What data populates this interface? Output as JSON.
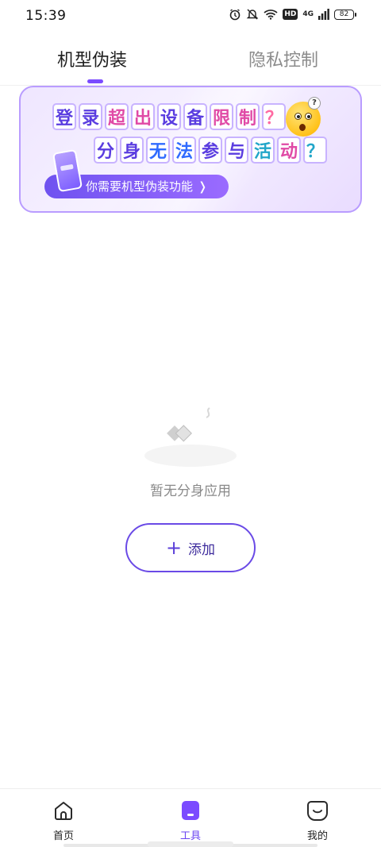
{
  "status_bar": {
    "time": "15:39",
    "hd": "HD",
    "network": "4G",
    "battery": "82",
    "icons": [
      "alarm-icon",
      "mute-icon",
      "wifi-icon",
      "hd-badge",
      "signal-icon",
      "battery-icon"
    ]
  },
  "tabs": [
    {
      "label": "机型伪装",
      "active": true
    },
    {
      "label": "隐私控制",
      "active": false
    }
  ],
  "banner": {
    "line1": [
      "登",
      "录",
      "超",
      "出",
      "设",
      "备",
      "限",
      "制",
      "？"
    ],
    "line2": [
      "分",
      "身",
      "无",
      "法",
      "参",
      "与",
      "活",
      "动",
      "？"
    ],
    "emoji_badge": "?",
    "pill_text": "你需要机型伪装功能",
    "pill_chevron": "❭"
  },
  "empty_state": {
    "message": "暂无分身应用"
  },
  "add_button": {
    "icon": "+",
    "label": "添加"
  },
  "bottom_nav": [
    {
      "label": "首页",
      "icon": "home-icon",
      "active": false
    },
    {
      "label": "工具",
      "icon": "tools-icon",
      "active": true
    },
    {
      "label": "我的",
      "icon": "profile-icon",
      "active": false
    }
  ],
  "colors": {
    "accent": "#6b44f2",
    "tab_inactive": "#8c8c8c",
    "empty_text": "#8a8a8a"
  }
}
